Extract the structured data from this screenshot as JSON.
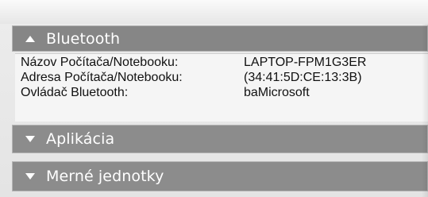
{
  "sections": [
    {
      "title": "Bluetooth",
      "expanded": true
    },
    {
      "title": "Aplikácia",
      "expanded": false
    },
    {
      "title": "Merné jednotky",
      "expanded": false
    }
  ],
  "bluetooth": {
    "rows": [
      {
        "label": "Názov Počítača/Notebooku:",
        "value": "LAPTOP-FPM1G3ER"
      },
      {
        "label": "Adresa Počítača/Notebooku:",
        "value": "(34:41:5D:CE:13:3B)"
      },
      {
        "label": "Ovládač Bluetooth:",
        "value": "baMicrosoft"
      }
    ]
  },
  "colors": {
    "header_bg": "#8c8c8c",
    "header_text": "#ffffff",
    "content_bg": "#f5f5f5"
  },
  "icons": {
    "expanded": "chevron-up-icon",
    "collapsed": "chevron-down-icon"
  }
}
